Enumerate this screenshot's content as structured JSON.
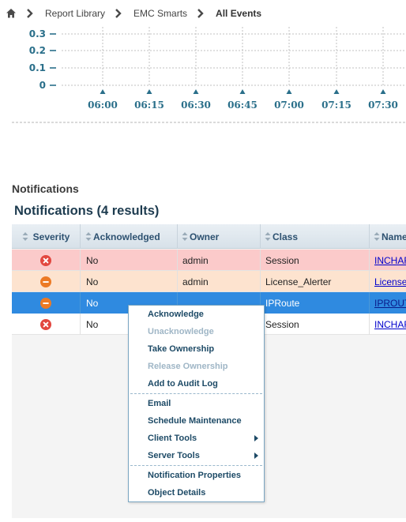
{
  "breadcrumb": {
    "items": [
      "Report Library",
      "EMC Smarts",
      "All Events"
    ]
  },
  "chart_data": {
    "type": "line",
    "y_tick_labels": [
      "0.3",
      "0.2",
      "0.1",
      "0"
    ],
    "x_tick_labels": [
      "06:00",
      "06:15",
      "06:30",
      "06:45",
      "07:00",
      "07:15",
      "07:30"
    ],
    "series": [],
    "grid": true
  },
  "notifications": {
    "section_title": "Notifications",
    "grid_title": "Notifications (4 results)",
    "columns": [
      "Severity",
      "Acknowledged",
      "Owner",
      "Class",
      "Name"
    ],
    "rows": [
      {
        "severity": "critical",
        "acknowledged": "No",
        "owner": "admin",
        "class": "Session",
        "name": "INCHAR",
        "selected": false
      },
      {
        "severity": "major",
        "acknowledged": "No",
        "owner": "admin",
        "class": "License_Alerter",
        "name": "License",
        "selected": false
      },
      {
        "severity": "major",
        "acknowledged": "No",
        "owner": "",
        "class": "IPRoute",
        "name": "IPROUT",
        "selected": true
      },
      {
        "severity": "critical",
        "acknowledged": "No",
        "owner": "",
        "class": "Session",
        "name": "INCHAR",
        "selected": false
      }
    ],
    "colors": {
      "critical_row": "#fbcaca",
      "major_row": "#fde3cf",
      "selected_row": "#2f8ae0",
      "critical_icon": "#e2473f",
      "major_icon": "#ec7a25"
    }
  },
  "context_menu": {
    "items": [
      {
        "label": "Acknowledge",
        "enabled": true,
        "submenu": false
      },
      {
        "label": "Unacknowledge",
        "enabled": false,
        "submenu": false
      },
      {
        "label": "Take Ownership",
        "enabled": true,
        "submenu": false
      },
      {
        "label": "Release Ownership",
        "enabled": false,
        "submenu": false
      },
      {
        "label": "Add to Audit Log",
        "enabled": true,
        "submenu": false
      },
      {
        "label": "Email",
        "enabled": true,
        "submenu": false
      },
      {
        "label": "Schedule Maintenance",
        "enabled": true,
        "submenu": false
      },
      {
        "label": "Client Tools",
        "enabled": true,
        "submenu": true
      },
      {
        "label": "Server Tools",
        "enabled": true,
        "submenu": true
      },
      {
        "label": "Notification Properties",
        "enabled": true,
        "submenu": false
      },
      {
        "label": "Object Details",
        "enabled": true,
        "submenu": false
      }
    ]
  }
}
